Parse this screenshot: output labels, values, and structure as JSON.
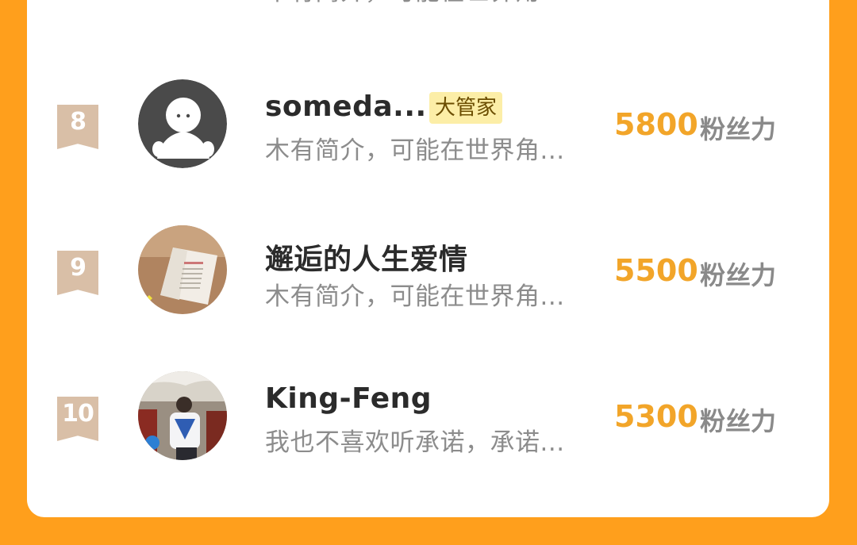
{
  "ranking": {
    "partial_top_bio": "木有简介，可能在世界角...",
    "items": [
      {
        "rank": "8",
        "name": "someda...",
        "badge": "大管家",
        "bio": "木有简介，可能在世界角...",
        "score": "5800",
        "unit": "粉丝力",
        "avatar": "default-user-icon"
      },
      {
        "rank": "9",
        "name": "邂逅的人生爱情",
        "badge": "",
        "bio": "木有简介，可能在世界角...",
        "score": "5500",
        "unit": "粉丝力",
        "avatar": "book-photo"
      },
      {
        "rank": "10",
        "name": "King-Feng",
        "badge": "",
        "bio": "我也不喜欢听承诺，承诺...",
        "score": "5300",
        "unit": "粉丝力",
        "avatar": "person-photo"
      }
    ]
  },
  "colors": {
    "background": "#FF9F1C",
    "score": "#F2A529",
    "rank_badge": "#D9BFA7",
    "role_badge": "#FCEEA7"
  }
}
